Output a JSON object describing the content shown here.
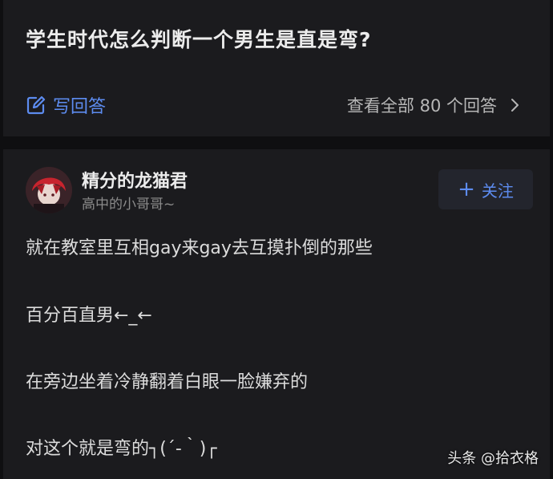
{
  "question": {
    "title": "学生时代怎么判断一个男生是直是弯?",
    "write_answer_label": "写回答",
    "view_all_label": "查看全部 80 个回答",
    "icons": {
      "write": "edit-square-icon",
      "more": "chevron-right-icon"
    }
  },
  "answer": {
    "author": {
      "name": "精分的龙猫君",
      "bio": "高中的小哥哥~",
      "avatar": "avatar"
    },
    "follow_label": "关注",
    "follow_icon": "plus-icon",
    "lines": [
      "就在教室里互相gay来gay去互摸扑倒的那些",
      "百分百直男←_←",
      "在旁边坐着冷静翻着白眼一脸嫌弃的",
      "对这个就是弯的┐(´-｀)┌"
    ]
  },
  "watermark": "头条 @拾衣格",
  "colors": {
    "background": "#0f0f11",
    "card": "#1b1b1e",
    "accent": "#5d8cf0",
    "text_primary": "#ececec",
    "text_secondary": "#8b8b8b"
  }
}
